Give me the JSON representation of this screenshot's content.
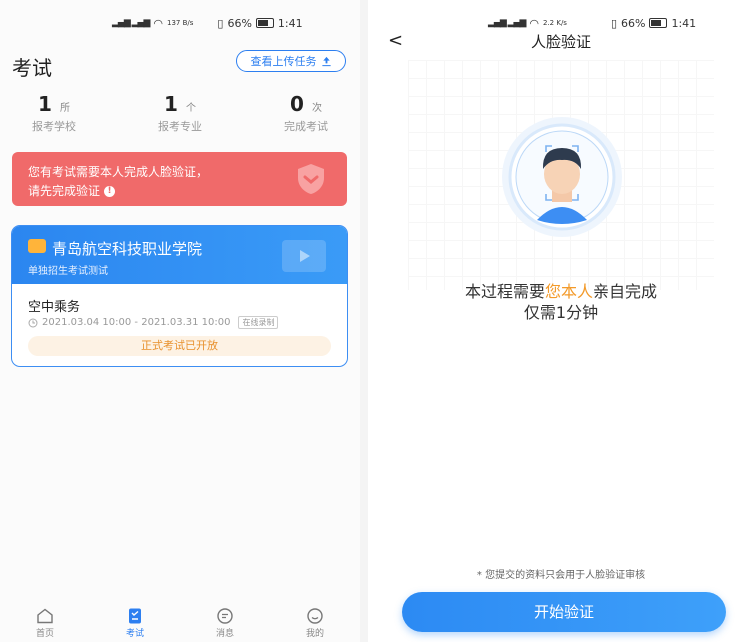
{
  "left": {
    "status": {
      "net": "137 B/s",
      "battery": "66%",
      "time": "1:41"
    },
    "header": {
      "title": "考试",
      "upload_button": "查看上传任务"
    },
    "stats": [
      {
        "value": "1",
        "unit": "所",
        "label": "报考学校"
      },
      {
        "value": "1",
        "unit": "个",
        "label": "报考专业"
      },
      {
        "value": "0",
        "unit": "次",
        "label": "完成考试"
      }
    ],
    "alert": {
      "line1": "您有考试需要本人完成人脸验证，",
      "line2": "请先完成验证"
    },
    "exam_card": {
      "school": "青岛航空科技职业学院",
      "subtitle": "单独招生考试测试",
      "major": "空中乘务",
      "time_range": "2021.03.04 10:00 - 2021.03.31 10:00",
      "tag": "在线录制",
      "status": "正式考试已开放"
    },
    "tabbar": [
      {
        "label": "首页",
        "icon": "home-icon"
      },
      {
        "label": "考试",
        "icon": "exam-icon"
      },
      {
        "label": "消息",
        "icon": "message-icon"
      },
      {
        "label": "我的",
        "icon": "profile-icon"
      }
    ]
  },
  "right": {
    "status": {
      "net": "2.2 K/s",
      "battery": "66%",
      "time": "1:41"
    },
    "header": {
      "back": "<",
      "title": "人脸验证"
    },
    "instruction": {
      "prefix": "本过程需要",
      "highlight": "您本人",
      "suffix": "亲自完成",
      "line2": "仅需1分钟"
    },
    "privacy_note": "* 您提交的资料只会用于人脸验证审核",
    "start_button": "开始验证"
  },
  "colors": {
    "accent": "#2d7ff0",
    "alert": "#f06a6a",
    "highlight": "#f39a2a",
    "status_orange": "#e8902c"
  }
}
